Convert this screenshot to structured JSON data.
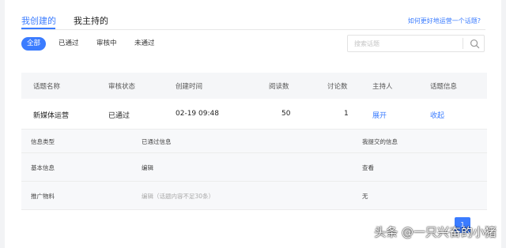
{
  "tabs": {
    "created": "我创建的",
    "hosted": "我主持的"
  },
  "help_link": "如何更好地运营一个话题?",
  "filters": [
    "全部",
    "已通过",
    "审核中",
    "未通过"
  ],
  "search": {
    "placeholder": "搜索话题"
  },
  "table": {
    "headers": [
      "话题名称",
      "审核状态",
      "创建时间",
      "阅读数",
      "讨论数",
      "主持人",
      "话题信息"
    ],
    "row": {
      "name": "新媒体运营",
      "status": "已通过",
      "created": "02-19 09:48",
      "reads": "50",
      "discussions": "1",
      "host_action": "展开",
      "info_action": "收起"
    }
  },
  "detail": {
    "headers": [
      "信息类型",
      "已通过信息",
      "我提交的信息"
    ],
    "rows": [
      {
        "type": "基本信息",
        "approved": "编辑",
        "submitted": "查看"
      },
      {
        "type": "推广物料",
        "approved": "编辑（话题内容不足30条）",
        "submitted": "无"
      }
    ]
  },
  "pagination": {
    "current": "1"
  },
  "watermark": "头条 @一只兴奋的小猪",
  "colors": {
    "accent": "#3b7cff"
  }
}
